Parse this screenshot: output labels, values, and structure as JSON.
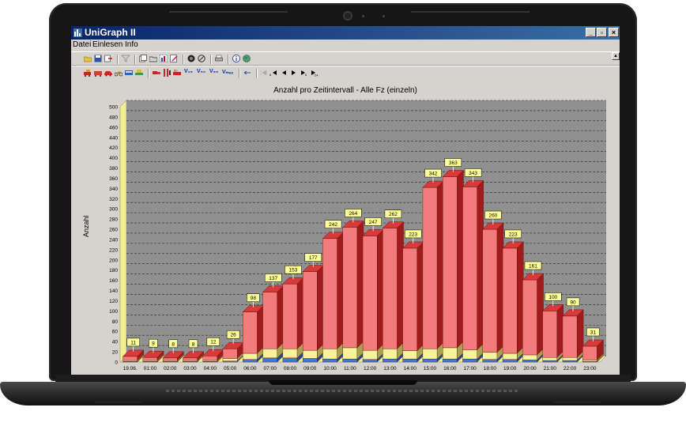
{
  "window": {
    "title": "UniGraph II",
    "controls": {
      "minimize": "_",
      "restore": "▫",
      "close": "×"
    }
  },
  "menu": [
    "Datei",
    "Einlesen",
    "Info"
  ],
  "toolbar2_labels": {
    "v15": "V₁₅",
    "v50": "V₅₀",
    "v85": "V₈₅",
    "vmax": "Vₘₐₓ"
  },
  "colors": {
    "bar": "#f27b7b",
    "bar_dark": "#a01c1c",
    "bar_top": "#d83a3a",
    "plot_bg": "#909090",
    "label_bg": "#ffff99",
    "titlebar": "#0a246a"
  },
  "chart_data": {
    "type": "bar",
    "title": "Anzahl pro Zeitintervall - Alle Fz (einzeln)",
    "ylabel": "Anzahl",
    "xlabel": "",
    "ylim": [
      0,
      500
    ],
    "yticks": [
      0,
      20,
      40,
      60,
      80,
      100,
      120,
      140,
      160,
      180,
      200,
      220,
      240,
      260,
      280,
      300,
      320,
      340,
      360,
      380,
      400,
      420,
      440,
      460,
      480,
      500
    ],
    "grid": true,
    "categories": [
      "19.06.",
      "01:00",
      "02:00",
      "03:00",
      "04:00",
      "05:00",
      "06:00",
      "07:00",
      "08:00",
      "09:00",
      "10:00",
      "11:00",
      "12:00",
      "13:00",
      "14:00",
      "15:00",
      "16:00",
      "17:00",
      "18:00",
      "19:00",
      "20:00",
      "21:00",
      "22:00",
      "23:00"
    ],
    "values": [
      11,
      9,
      8,
      8,
      12,
      26,
      98,
      137,
      153,
      177,
      242,
      264,
      247,
      262,
      223,
      342,
      363,
      343,
      260,
      223,
      161,
      100,
      90,
      31
    ],
    "series": [
      {
        "color": "#3a7ad6",
        "values": [
          1,
          1,
          1,
          1,
          1,
          2,
          5,
          8,
          8,
          7,
          6,
          6,
          5,
          6,
          6,
          6,
          6,
          6,
          5,
          5,
          4,
          3,
          3,
          1
        ]
      },
      {
        "color": "#f7f39a",
        "values": [
          2,
          2,
          2,
          2,
          2,
          5,
          12,
          18,
          18,
          16,
          20,
          22,
          18,
          20,
          16,
          20,
          22,
          18,
          14,
          12,
          10,
          6,
          6,
          3
        ]
      }
    ]
  }
}
